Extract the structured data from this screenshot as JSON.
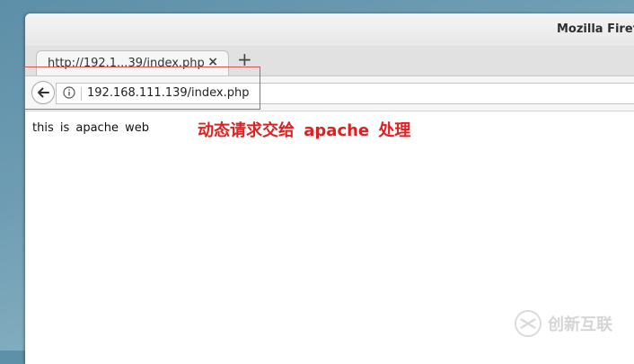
{
  "browser": {
    "title": "Mozilla Firefox",
    "tab": {
      "title": "http://192.1...39/index.php",
      "close_label": "×"
    },
    "new_tab_label": "+",
    "url": "192.168.111.139/index.php"
  },
  "page": {
    "body_text": "this is apache web"
  },
  "annotation": {
    "text": "动态请求交给 apache 处理",
    "color": "#e02020"
  },
  "watermark": {
    "text": "创新互联"
  },
  "icons": {
    "back": "back-arrow-icon",
    "info": "info-icon",
    "watermark_logo": "watermark-logo-icon"
  }
}
